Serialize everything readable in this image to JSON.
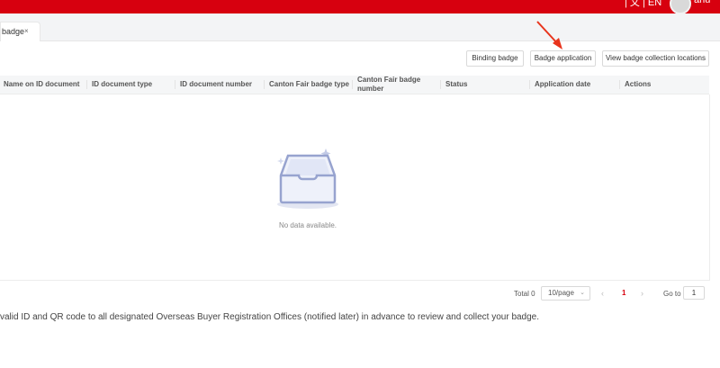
{
  "header": {
    "language": "| 文 | EN",
    "user_name": "anu"
  },
  "tabs": [
    {
      "label": "badge",
      "close_icon": "×"
    }
  ],
  "toolbar": {
    "binding_label": "Binding badge",
    "application_label": "Badge application",
    "locations_label": "View badge collection locations"
  },
  "table": {
    "columns": [
      "Name on ID document",
      "ID document type",
      "ID document number",
      "Canton Fair badge type",
      "Canton Fair badge number",
      "Status",
      "Application date",
      "Actions"
    ],
    "empty_text": "No data available."
  },
  "pagination": {
    "total": "Total 0",
    "page_size": "10/page",
    "current_page": "1",
    "goto_label": "Go to",
    "goto_value": "1"
  },
  "notice": "valid ID and QR code to all designated Overseas Buyer Registration Offices (notified later) in advance to review and collect your badge.",
  "colors": {
    "brand_red": "#d7000f",
    "annotation_arrow": "#e8341c"
  },
  "icons": {
    "empty": "empty-box-icon",
    "arrow": "red-arrow-annotation"
  }
}
